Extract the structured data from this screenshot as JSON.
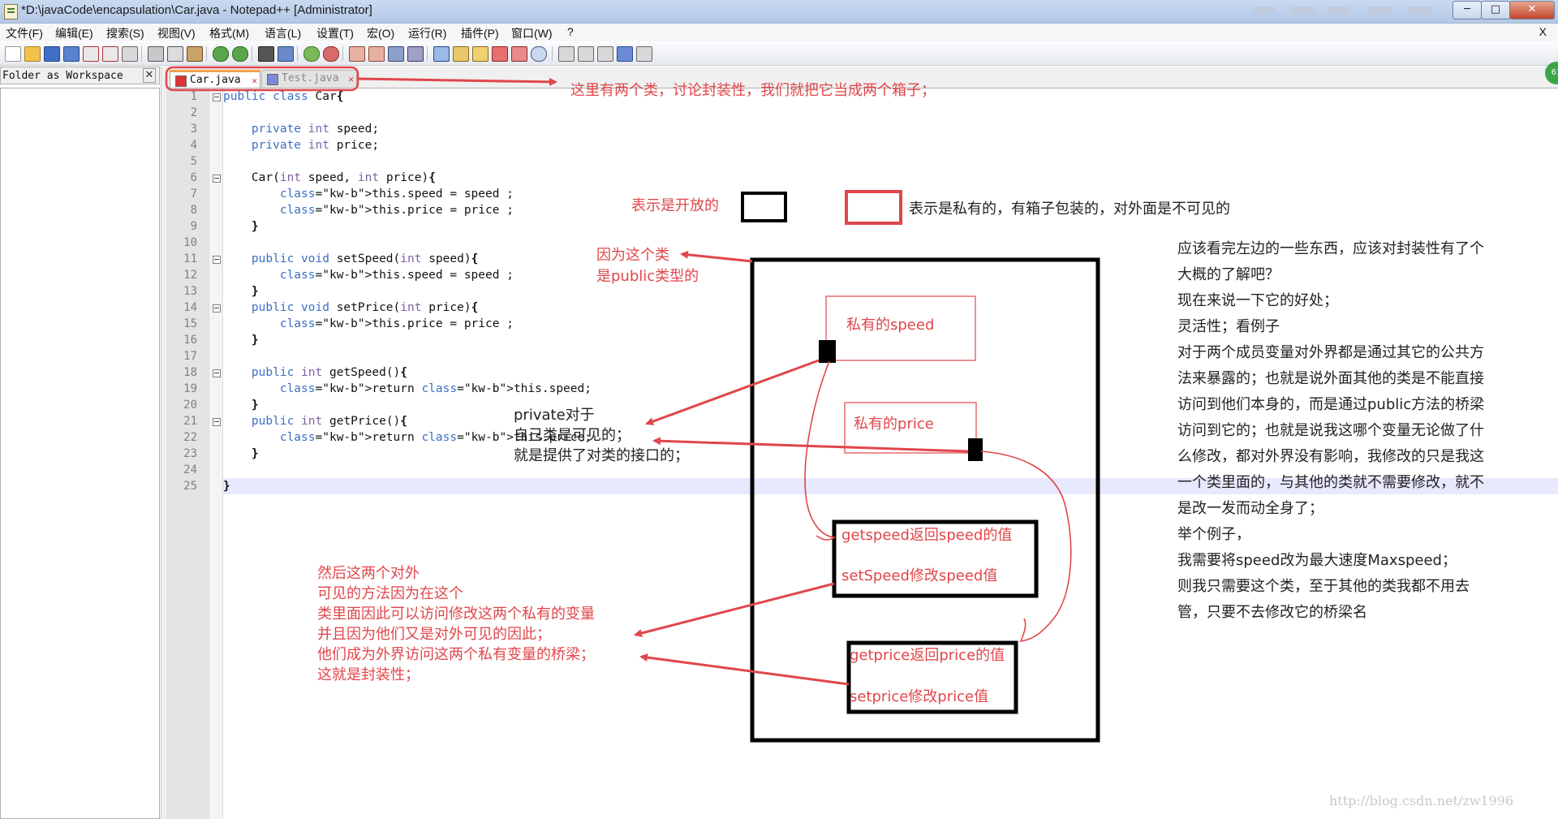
{
  "window": {
    "title": "*D:\\javaCode\\encapsulation\\Car.java - Notepad++ [Administrator]",
    "close_glyph": "✕",
    "menu_close": "X"
  },
  "menu": [
    "文件(F)",
    "编辑(E)",
    "搜索(S)",
    "视图(V)",
    "格式(M)",
    "语言(L)",
    "设置(T)",
    "宏(O)",
    "运行(R)",
    "插件(P)",
    "窗口(W)",
    "?"
  ],
  "panel": {
    "title": "Folder as Workspace",
    "close": "✕"
  },
  "tabs": [
    {
      "label": "Car.java",
      "close": "✕"
    },
    {
      "label": "Test.java",
      "close": "✕"
    }
  ],
  "status_badge": "61",
  "code": [
    "public class Car{",
    "",
    "    private int speed;",
    "    private int price;",
    "",
    "    Car(int speed, int price){",
    "        this.speed = speed ;",
    "        this.price = price ;",
    "    }",
    "",
    "    public void setSpeed(int speed){",
    "        this.speed = speed ;",
    "    }",
    "    public void setPrice(int price){",
    "        this.price = price ;",
    "    }",
    "",
    "    public int getSpeed(){",
    "        return this.speed;",
    "    }",
    "    public int getPrice(){",
    "        return this.price;",
    "    }",
    "",
    "}"
  ],
  "annotations": {
    "tabs_note": "这里有两个类，讨论封装性，我们就把它当成两个箱子；",
    "open_label": "表示是开放的",
    "private_label": "表示是私有的，有箱子包装的，对外面是不可见的",
    "public_class_1": "因为这个类",
    "public_class_2": "是public类型的",
    "private_speed": "私有的speed",
    "private_price": "私有的price",
    "private_visible_1": "private对于",
    "private_visible_2": "自己类是可见的；",
    "private_visible_3": "就是提供了对类的接口的；",
    "getspeed": "getspeed返回speed的值",
    "setspeed": "setSpeed修改speed值",
    "getprice": "getprice返回price的值",
    "setprice": "setprice修改price值",
    "bridge": [
      "然后这两个对外",
      "可见的方法因为在这个",
      "类里面因此可以访问修改这两个私有的变量",
      "并且因为他们又是对外可见的因此；",
      "他们成为外界访问这两个私有变量的桥梁；",
      "这就是封装性；"
    ],
    "explanation": [
      "应该看完左边的一些东西，应该对封装性有了个",
      "大概的了解吧？",
      "现在来说一下它的好处；",
      "灵活性；看例子",
      "对于两个成员变量对外界都是通过其它的公共方",
      "法来暴露的；也就是说外面其他的类是不能直接",
      "访问到他们本身的，而是通过public方法的桥梁",
      "访问到它的；也就是说我这哪个变量无论做了什",
      "么修改，都对外界没有影响，我修改的只是我这",
      "一个类里面的，与其他的类就不需要修改，就不",
      "是改一发而动全身了；",
      "举个例子，",
      "我需要将speed改为最大速度Maxspeed；",
      "则我只需要这个类，至于其他的类我都不用去",
      "管，只要不去修改它的桥梁名"
    ]
  },
  "watermark": "http://blog.csdn.net/zw1996",
  "colors": {
    "annotation_red": "#e0464a",
    "keyword": "#3b6fc4"
  }
}
